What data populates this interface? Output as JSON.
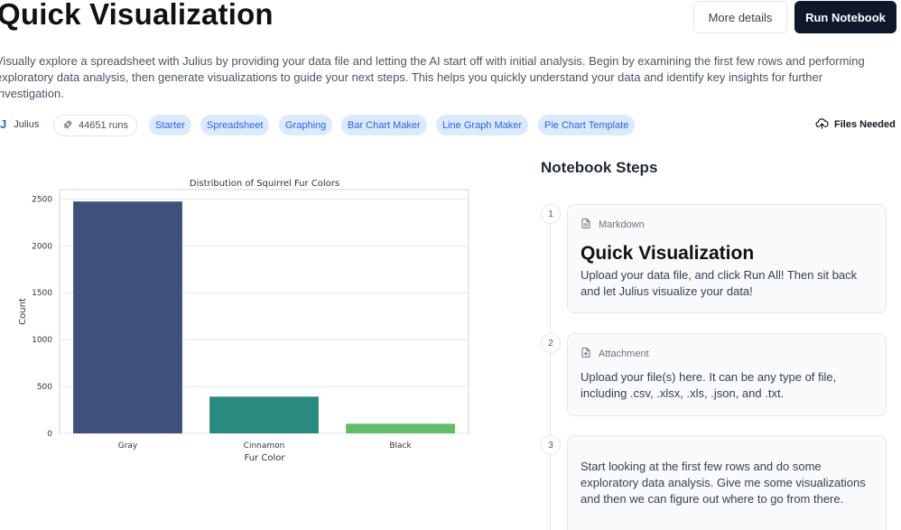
{
  "header": {
    "title": "Quick Visualization",
    "more_details": "More details",
    "run_notebook": "Run Notebook"
  },
  "description": "Visually explore a spreadsheet with Julius by providing your data file and letting the AI start off with initial analysis. Begin by examining the first few rows and performing exploratory data analysis, then generate visualizations to guide your next steps. This helps you quickly understand your data and identify key insights for further investigation.",
  "meta": {
    "author_logo": "J",
    "author": "Julius",
    "runs": "44651 runs",
    "tags": [
      "Starter",
      "Spreadsheet",
      "Graphing",
      "Bar Chart Maker",
      "Line Graph Maker",
      "Pie Chart Template"
    ],
    "files_needed": "Files Needed"
  },
  "chart_data": {
    "type": "bar",
    "title": "Distribution of Squirrel Fur Colors",
    "xlabel": "Fur Color",
    "ylabel": "Count",
    "categories": [
      "Gray",
      "Cinnamon",
      "Black"
    ],
    "values": [
      2473,
      392,
      103
    ],
    "colors": [
      "#3f4f7e",
      "#2a8a7f",
      "#5fbf65"
    ],
    "ylim": [
      0,
      2600
    ],
    "yticks": [
      0,
      500,
      1000,
      1500,
      2000,
      2500
    ],
    "grid": true
  },
  "steps": {
    "title": "Notebook Steps",
    "items": [
      {
        "num": "1",
        "kind": "Markdown",
        "heading": "Quick Visualization",
        "text": "Upload your data file, and click Run All! Then sit back and let Julius visualize your data!"
      },
      {
        "num": "2",
        "kind": "Attachment",
        "text": "Upload your file(s) here. It can be any type of file, including .csv, .xlsx, .xls, .json, and .txt."
      },
      {
        "num": "3",
        "text": "Start looking at the first few rows and do some exploratory data analysis. Give me some visualizations and then we can figure out where to go from there."
      }
    ]
  }
}
